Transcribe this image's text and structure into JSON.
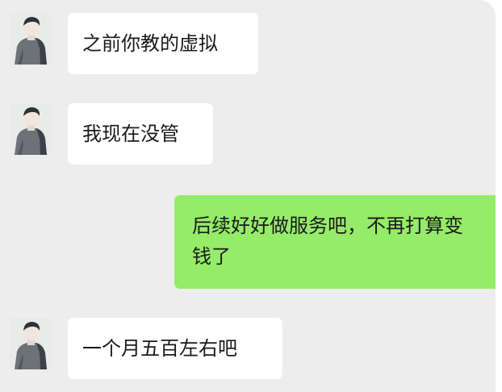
{
  "conversation": {
    "messages": [
      {
        "side": "left",
        "text": "之前你教的虚拟"
      },
      {
        "side": "left",
        "text": "我现在没管"
      },
      {
        "side": "right",
        "line1": "后续好好做服务吧，不再打算变",
        "line2": "钱了"
      },
      {
        "side": "left",
        "text": "一个月五百左右吧"
      }
    ]
  },
  "colors": {
    "chat_background": "#ededed",
    "incoming_bubble": "#ffffff",
    "outgoing_bubble": "#95ec69",
    "text": "#1a1a1a"
  },
  "icons": {
    "contact_avatar": "avatar-illustration-icon"
  }
}
